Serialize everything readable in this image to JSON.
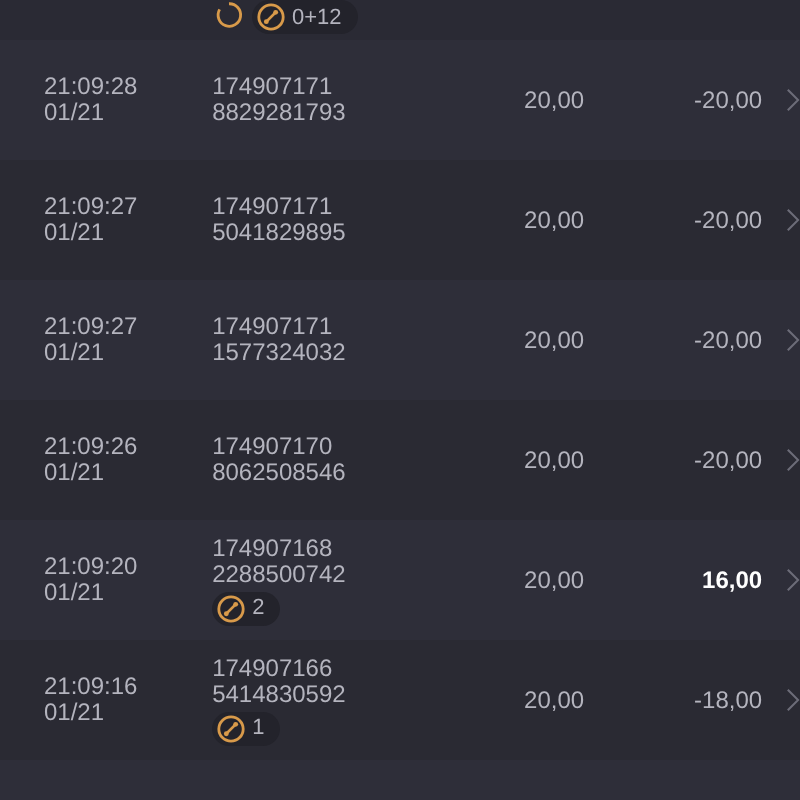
{
  "top_row": {
    "badge": {
      "count": "0+12"
    }
  },
  "rows": [
    {
      "time": "21:09:28",
      "date": "01/21",
      "id_line_1": "174907171",
      "id_line_2": "8829281793",
      "amount": "20,00",
      "result": "-20,00",
      "win": false
    },
    {
      "time": "21:09:27",
      "date": "01/21",
      "id_line_1": "174907171",
      "id_line_2": "5041829895",
      "amount": "20,00",
      "result": "-20,00",
      "win": false
    },
    {
      "time": "21:09:27",
      "date": "01/21",
      "id_line_1": "174907171",
      "id_line_2": "1577324032",
      "amount": "20,00",
      "result": "-20,00",
      "win": false
    },
    {
      "time": "21:09:26",
      "date": "01/21",
      "id_line_1": "174907170",
      "id_line_2": "8062508546",
      "amount": "20,00",
      "result": "-20,00",
      "win": false
    },
    {
      "time": "21:09:20",
      "date": "01/21",
      "id_line_1": "174907168",
      "id_line_2": "2288500742",
      "badge": {
        "count": "2"
      },
      "amount": "20,00",
      "result": "16,00",
      "win": true
    },
    {
      "time": "21:09:16",
      "date": "01/21",
      "id_line_1": "174907166",
      "id_line_2": "5414830592",
      "badge": {
        "count": "1"
      },
      "amount": "20,00",
      "result": "-18,00",
      "win": false
    }
  ]
}
